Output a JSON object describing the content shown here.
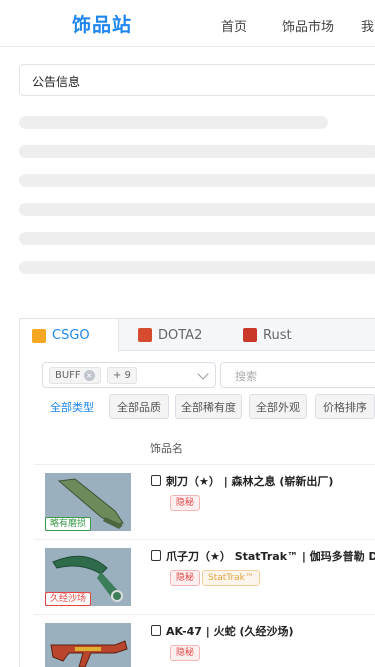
{
  "header": {
    "logo": "饰品站",
    "nav": [
      "首页",
      "饰品市场",
      "我的"
    ]
  },
  "notice": {
    "text": "公告信息"
  },
  "tabs": [
    {
      "label": "CSGO",
      "icon": "csgo-icon",
      "color": "#f5a623"
    },
    {
      "label": "DOTA2",
      "icon": "dota2-icon",
      "color": "#d64b2f"
    },
    {
      "label": "Rust",
      "icon": "rust-icon",
      "color": "#c9362a"
    }
  ],
  "filters": {
    "platform_chip": "BUFF",
    "more_chip": "+ 9",
    "search_placeholder": "搜索",
    "buttons": [
      "全部类型",
      "全部品质",
      "全部稀有度",
      "全部外观",
      "价格排序"
    ]
  },
  "table": {
    "column_header": "饰品名"
  },
  "items": [
    {
      "name": "刺刀（★） | 森林之息 (崭新出厂)",
      "badge": "略有磨损",
      "badge_color": "#3a9a4a",
      "tags": [
        {
          "text": "隐秘",
          "style": "red"
        }
      ]
    },
    {
      "name": "爪子刀（★） StatTrak™ | 伽玛多普勒 DD...",
      "badge": "久经沙场",
      "badge_color": "#e64340",
      "tags": [
        {
          "text": "隐秘",
          "style": "red"
        },
        {
          "text": "StatTrak™",
          "style": "orange"
        }
      ]
    },
    {
      "name": "AK-47 | 火蛇 (久经沙场)",
      "badge": "",
      "badge_color": "#e64340",
      "tags": [
        {
          "text": "隐秘",
          "style": "red"
        }
      ]
    }
  ]
}
